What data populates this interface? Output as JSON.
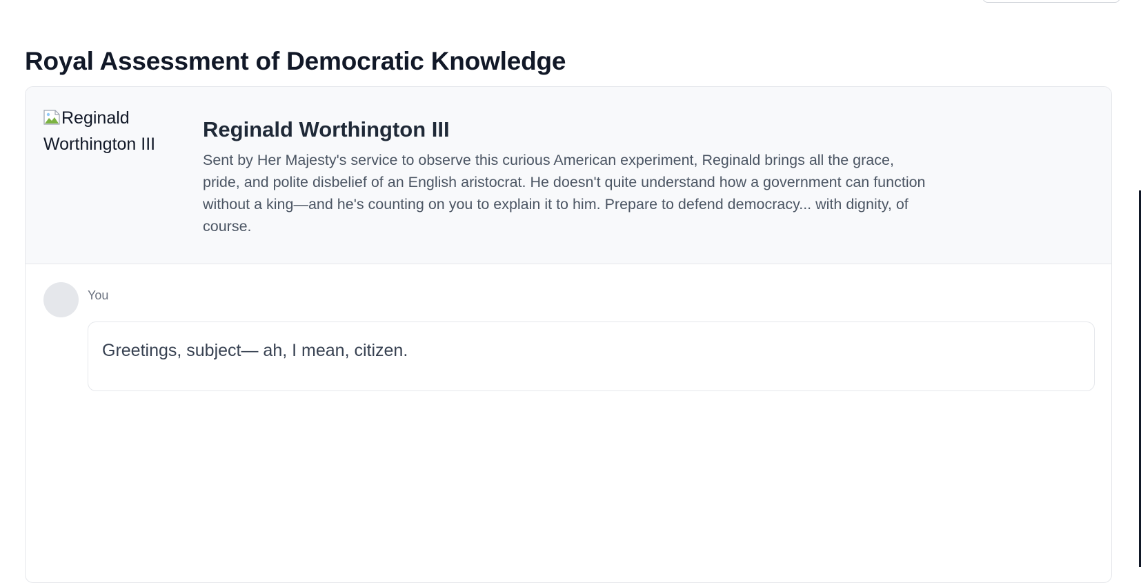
{
  "header": {
    "page_title": "Royal Assessment of Democratic Knowledge"
  },
  "persona": {
    "image_alt": "Reginald Worthington III",
    "name": "Reginald Worthington III",
    "description": "Sent by Her Majesty's service to observe this curious American experiment, Reginald brings all the grace, pride, and polite disbelief of an English aristocrat. He doesn't quite understand how a government can function without a king—and he's counting on you to explain it to him. Prepare to defend democracy... with dignity, of course."
  },
  "chat": {
    "messages": [
      {
        "author": "You",
        "text": "Greetings, subject— ah, I mean, citizen."
      }
    ]
  },
  "icons": {
    "broken_image": "broken-image-icon"
  },
  "colors": {
    "title": "#111827",
    "persona_bg": "#f8f9fb",
    "body_text": "#4b5563",
    "border": "#e5e7eb"
  }
}
